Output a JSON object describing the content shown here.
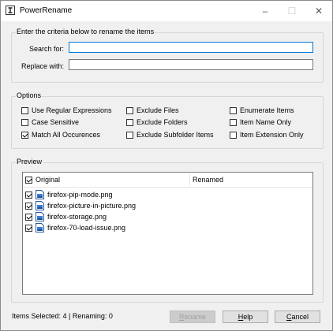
{
  "window": {
    "title": "PowerRename",
    "controls": {
      "minimize": "–",
      "maximize": "☐",
      "close": "✕"
    }
  },
  "criteria": {
    "group_label": "Enter the criteria below to rename the items",
    "search_label": "Search for:",
    "search_value": "",
    "replace_label": "Replace with:",
    "replace_value": ""
  },
  "options": {
    "group_label": "Options",
    "items": [
      {
        "label": "Use Regular Expressions",
        "checked": false
      },
      {
        "label": "Case Sensitive",
        "checked": false
      },
      {
        "label": "Match All Occurences",
        "checked": true
      },
      {
        "label": "Exclude Files",
        "checked": false
      },
      {
        "label": "Exclude Folders",
        "checked": false
      },
      {
        "label": "Exclude Subfolder Items",
        "checked": false
      },
      {
        "label": "Enumerate Items",
        "checked": false
      },
      {
        "label": "Item Name Only",
        "checked": false
      },
      {
        "label": "Item Extension Only",
        "checked": false
      }
    ]
  },
  "preview": {
    "group_label": "Preview",
    "columns": {
      "original": "Original",
      "renamed": "Renamed"
    },
    "header_checked": true,
    "rows": [
      {
        "name": "firefox-pip-mode.png",
        "checked": true
      },
      {
        "name": "firefox-picture-in-picture.png",
        "checked": true
      },
      {
        "name": "firefox-storage.png",
        "checked": true
      },
      {
        "name": "firefox-70-load-issue.png",
        "checked": true
      }
    ]
  },
  "status": {
    "text": "Items Selected: 4 | Renaming: 0"
  },
  "buttons": {
    "rename": {
      "hotkey": "R",
      "rest": "ename"
    },
    "help": {
      "hotkey": "H",
      "rest": "elp"
    },
    "cancel": {
      "hotkey": "C",
      "rest": "ancel"
    }
  }
}
